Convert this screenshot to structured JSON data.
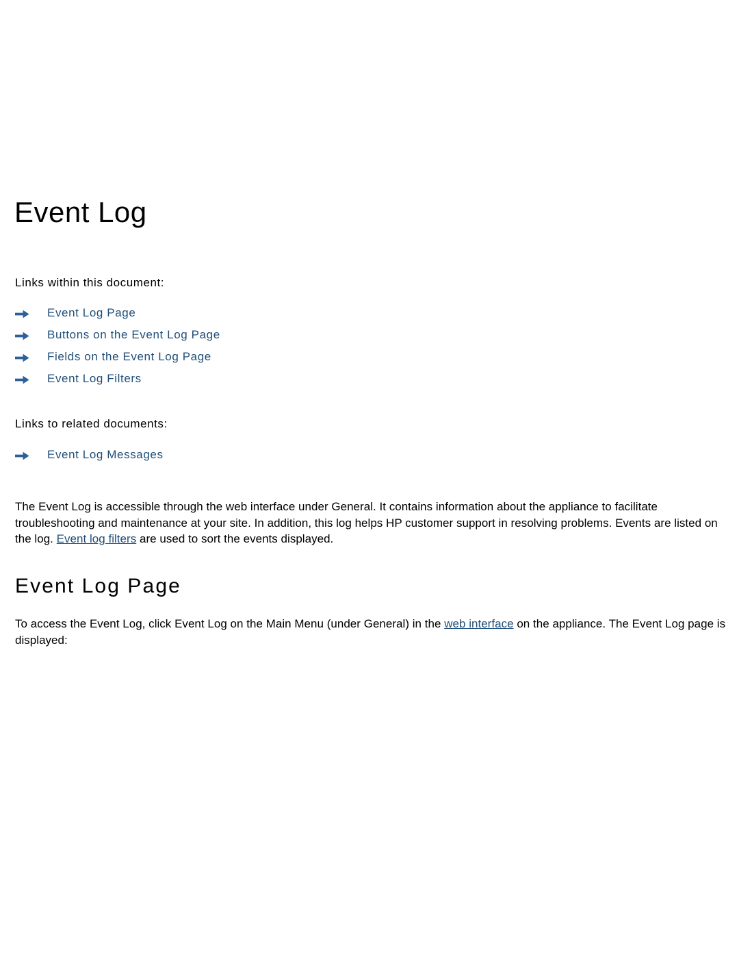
{
  "document": {
    "title": "Event Log",
    "links_within_label": "Links within this document:",
    "links_related_label": "Links to related documents:",
    "arrow_icon_name": "arrow-right-icon",
    "link_color": "#1f4e79",
    "arrow_color": "#2d6098",
    "text_color": "#000000",
    "background_color": "#ffffff"
  },
  "links_within": [
    {
      "label": "Event Log Page"
    },
    {
      "label": "Buttons on the Event Log Page"
    },
    {
      "label": "Fields on the Event Log Page"
    },
    {
      "label": "Event Log Filters"
    }
  ],
  "links_related": [
    {
      "label": "Event Log Messages"
    }
  ],
  "intro_paragraph": {
    "part1": "The Event Log is accessible through the web interface under General. It contains information about the appliance to facilitate troubleshooting and maintenance at your site. In addition, this log helps HP customer support in resolving problems. Events are listed on the log. ",
    "link": "Event log filters",
    "part2": " are used to sort the events displayed."
  },
  "sub_heading": "Event Log Page",
  "access_paragraph": {
    "part1": "To access the Event Log, click Event Log on the Main Menu (under General) in the ",
    "link": "web interface",
    "part2": " on the appliance. The Event Log page is displayed:"
  }
}
